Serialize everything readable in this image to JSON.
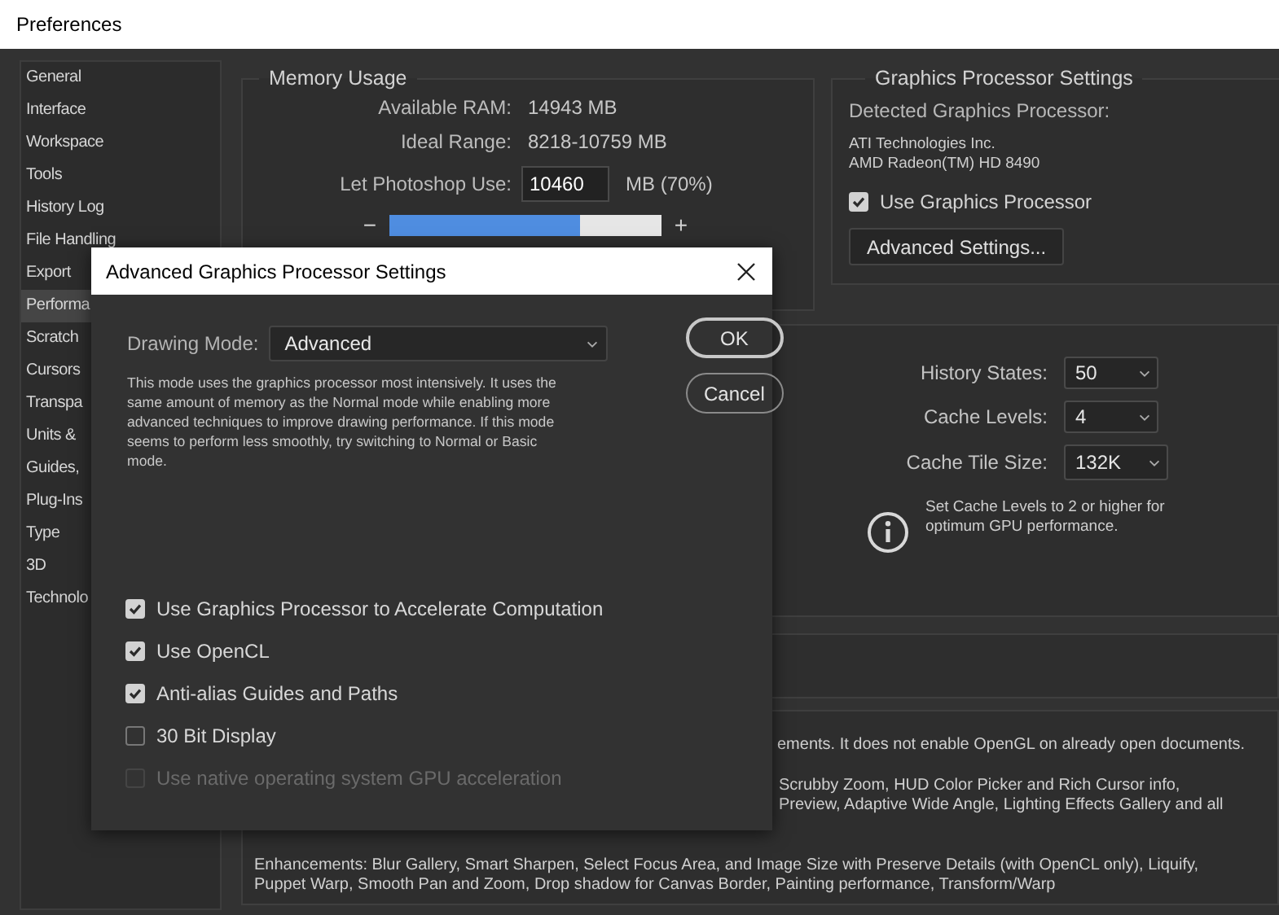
{
  "window": {
    "title": "Preferences"
  },
  "sidebar": {
    "items": [
      {
        "label": "General",
        "selected": false
      },
      {
        "label": "Interface",
        "selected": false
      },
      {
        "label": "Workspace",
        "selected": false
      },
      {
        "label": "Tools",
        "selected": false
      },
      {
        "label": "History Log",
        "selected": false
      },
      {
        "label": "File Handling",
        "selected": false
      },
      {
        "label": "Export",
        "selected": false
      },
      {
        "label": "Performa",
        "selected": true
      },
      {
        "label": "Scratch",
        "selected": false
      },
      {
        "label": "Cursors",
        "selected": false
      },
      {
        "label": "Transpa",
        "selected": false
      },
      {
        "label": "Units &",
        "selected": false
      },
      {
        "label": "Guides,",
        "selected": false
      },
      {
        "label": "Plug-Ins",
        "selected": false
      },
      {
        "label": "Type",
        "selected": false
      },
      {
        "label": "3D",
        "selected": false
      },
      {
        "label": "Technolo",
        "selected": false
      }
    ]
  },
  "memory_usage": {
    "title": "Memory Usage",
    "rows": [
      {
        "label": "Available RAM:",
        "value": "14943 MB"
      },
      {
        "label": "Ideal Range:",
        "value": "8218-10759 MB"
      }
    ],
    "let_use": {
      "label": "Let Photoshop Use:",
      "value": "10460",
      "unit": "MB (70%)"
    },
    "slider": {
      "minus": "−",
      "plus": "+",
      "level": 0.7
    }
  },
  "graphics_processor": {
    "title": "Graphics Processor Settings",
    "detected_label": "Detected Graphics Processor:",
    "processor_lines": [
      "ATI Technologies Inc.",
      "AMD Radeon(TM) HD 8490"
    ],
    "use_gpu": {
      "label": "Use Graphics Processor",
      "checked": true
    },
    "advanced_button": "Advanced Settings..."
  },
  "history_cache": {
    "fields": [
      {
        "label": "History States:",
        "value": "50"
      },
      {
        "label": "Cache Levels:",
        "value": "4"
      },
      {
        "label": "Cache Tile Size:",
        "value": "132K"
      }
    ],
    "info": "Set Cache Levels to 2 or higher for optimum GPU performance."
  },
  "description": {
    "lines": [
      "ements. It does not enable OpenGL on already open documents.",
      "Scrubby Zoom, HUD Color Picker and Rich Cursor info,",
      "Preview, Adaptive Wide Angle, Lighting Effects Gallery and all"
    ],
    "enhancements": "Enhancements: Blur Gallery, Smart Sharpen, Select Focus Area, and Image Size with Preserve Details (with OpenCL only), Liquify, Puppet Warp, Smooth Pan and Zoom, Drop shadow for Canvas Border, Painting performance, Transform/Warp"
  },
  "dialog": {
    "title": "Advanced Graphics Processor Settings",
    "drawing_mode": {
      "label": "Drawing Mode:",
      "value": "Advanced"
    },
    "description": "This mode uses the graphics processor most intensively.  It uses the same amount of memory as the Normal mode while enabling more advanced techniques to improve drawing performance.  If this mode seems to perform less smoothly, try switching to Normal or Basic mode.",
    "options": [
      {
        "label": "Use Graphics Processor to Accelerate Computation",
        "checked": true,
        "disabled": false
      },
      {
        "label": "Use OpenCL",
        "checked": true,
        "disabled": false
      },
      {
        "label": "Anti-alias Guides and Paths",
        "checked": true,
        "disabled": false
      },
      {
        "label": "30 Bit Display",
        "checked": false,
        "disabled": false
      },
      {
        "label": "Use native operating system GPU acceleration",
        "checked": false,
        "disabled": true
      }
    ],
    "buttons": [
      "OK",
      "Cancel"
    ]
  }
}
